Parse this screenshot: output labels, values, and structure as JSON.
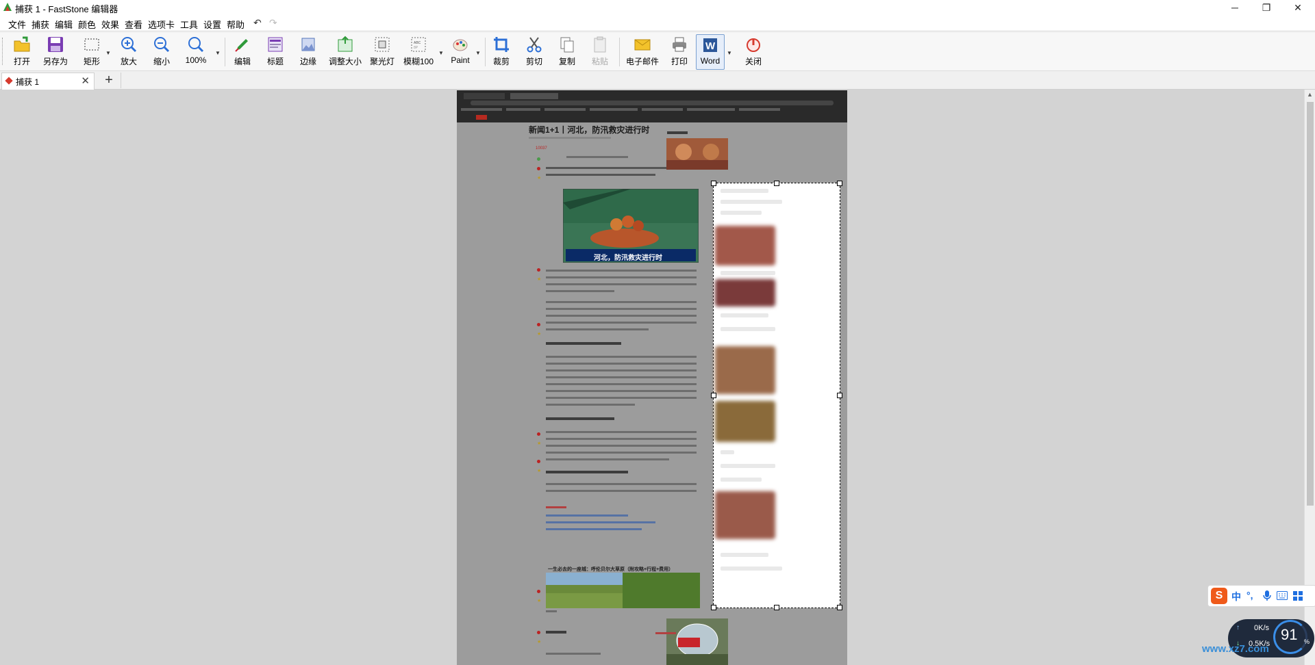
{
  "window": {
    "title": "捕获 1 - FastStone 编辑器",
    "minimize": "─",
    "maximize": "❐",
    "close": "✕"
  },
  "menu": [
    "文件",
    "捕获",
    "编辑",
    "颜色",
    "效果",
    "查看",
    "选项卡",
    "工具",
    "设置",
    "帮助"
  ],
  "undo_icon": "↶",
  "redo_icon": "↷",
  "toolbar": {
    "open": "打开",
    "save_as": "另存为",
    "rectangle": "矩形",
    "zoom_in": "放大",
    "zoom_out": "缩小",
    "zoom": "100%",
    "edit": "编辑",
    "caption": "标题",
    "edge": "边缘",
    "resize": "调整大小",
    "spotlight": "聚光灯",
    "blur": "模糊100",
    "paint": "Paint",
    "crop": "裁剪",
    "cut": "剪切",
    "copy": "复制",
    "paste": "粘贴",
    "email": "电子邮件",
    "print": "打印",
    "word": "Word",
    "close": "关闭"
  },
  "tabs": {
    "active": "捕获 1",
    "close": "✕",
    "add": "+"
  },
  "captured": {
    "headline": "新闻1+1丨河北，防汛救灾进行时",
    "video_caption": "河北，防汛救灾进行时",
    "related": "一生必去的一座城：呼伦贝尔大草原（附攻略+行程+费用）",
    "comment_count": "10037"
  },
  "ime": {
    "logo": "S",
    "mode": "中",
    "punct": "°,"
  },
  "netwidget": {
    "up_speed": "0K/s",
    "down_speed": "0.5K/s",
    "up_arrow": "↑",
    "down_arrow": "↓",
    "percent": "91",
    "pct_sign": "%"
  },
  "watermark": "www.xz7.com",
  "colors": {
    "accent_red": "#d63a2e",
    "canvas_bg": "#d3d3d3",
    "selection": "#ffffff",
    "ime_orange": "#ef5a1a",
    "ime_blue": "#1f6fe0"
  }
}
